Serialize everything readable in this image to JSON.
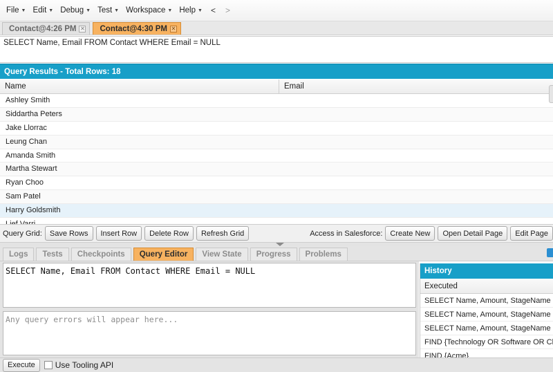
{
  "menu": {
    "items": [
      {
        "label": "File"
      },
      {
        "label": "Edit"
      },
      {
        "label": "Debug"
      },
      {
        "label": "Test"
      },
      {
        "label": "Workspace"
      },
      {
        "label": "Help"
      }
    ],
    "back": "<",
    "forward": ">"
  },
  "file_tabs": [
    {
      "label": "Contact@4:26 PM",
      "active": false
    },
    {
      "label": "Contact@4:30 PM",
      "active": true
    }
  ],
  "query_text": "SELECT Name, Email FROM Contact WHERE Email = NULL",
  "results": {
    "title": "Query Results - Total Rows: 18",
    "columns": [
      "Name",
      "Email"
    ],
    "rows": [
      {
        "name": "Ashley Smith",
        "email": ""
      },
      {
        "name": "Siddartha Peters",
        "email": ""
      },
      {
        "name": "Jake Llorrac",
        "email": ""
      },
      {
        "name": "Leung Chan",
        "email": ""
      },
      {
        "name": "Amanda Smith",
        "email": ""
      },
      {
        "name": "Martha Stewart",
        "email": ""
      },
      {
        "name": "Ryan Choo",
        "email": ""
      },
      {
        "name": "Sam Patel",
        "email": ""
      },
      {
        "name": "Harry Goldsmith",
        "email": ""
      },
      {
        "name": "Lief Varri",
        "email": ""
      }
    ],
    "selected_row": 8
  },
  "actions": {
    "query_grid_label": "Query Grid:",
    "save_rows": "Save Rows",
    "insert_row": "Insert Row",
    "delete_row": "Delete Row",
    "refresh_grid": "Refresh Grid",
    "access_label": "Access in Salesforce:",
    "create_new": "Create New",
    "open_detail": "Open Detail Page",
    "edit_page": "Edit Page"
  },
  "bottom_tabs": [
    {
      "label": "Logs",
      "active": false
    },
    {
      "label": "Tests",
      "active": false
    },
    {
      "label": "Checkpoints",
      "active": false
    },
    {
      "label": "Query Editor",
      "active": true
    },
    {
      "label": "View State",
      "active": false
    },
    {
      "label": "Progress",
      "active": false
    },
    {
      "label": "Problems",
      "active": false
    }
  ],
  "editor": {
    "query": "SELECT Name, Email FROM Contact WHERE Email = NULL",
    "errors_placeholder": "Any query errors will appear here..."
  },
  "history": {
    "title": "History",
    "column": "Executed",
    "items": [
      "SELECT Name, Amount, StageName F...",
      "SELECT Name, Amount, StageName F...",
      "SELECT Name, Amount, StageName F...",
      "FIND {Technology OR Software OR Cl...",
      "FIND {Acme}"
    ]
  },
  "footer": {
    "execute": "Execute",
    "tooling_label": "Use Tooling API",
    "tooling_checked": false
  },
  "colors": {
    "accent_blue": "#179fc8",
    "active_tab_orange": "#f7b260"
  }
}
